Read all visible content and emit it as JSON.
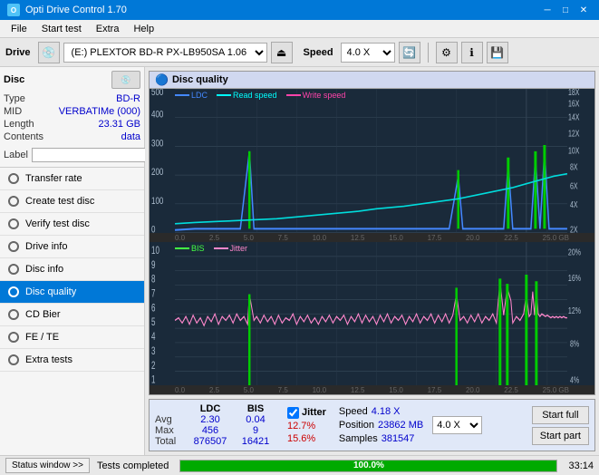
{
  "titlebar": {
    "title": "Opti Drive Control 1.70",
    "icon": "O"
  },
  "menu": {
    "items": [
      "File",
      "Start test",
      "Extra",
      "Help"
    ]
  },
  "toolbar": {
    "drive_label": "Drive",
    "drive_value": "(E:)  PLEXTOR BD-R  PX-LB950SA 1.06",
    "speed_label": "Speed",
    "speed_value": "4.0 X"
  },
  "sidebar": {
    "disc_title": "Disc",
    "disc_info": {
      "type_label": "Type",
      "type_value": "BD-R",
      "mid_label": "MID",
      "mid_value": "VERBATIMe (000)",
      "length_label": "Length",
      "length_value": "23.31 GB",
      "contents_label": "Contents",
      "contents_value": "data",
      "label_label": "Label"
    },
    "nav_items": [
      {
        "id": "transfer-rate",
        "label": "Transfer rate",
        "active": false
      },
      {
        "id": "create-test-disc",
        "label": "Create test disc",
        "active": false
      },
      {
        "id": "verify-test-disc",
        "label": "Verify test disc",
        "active": false
      },
      {
        "id": "drive-info",
        "label": "Drive info",
        "active": false
      },
      {
        "id": "disc-info",
        "label": "Disc info",
        "active": false
      },
      {
        "id": "disc-quality",
        "label": "Disc quality",
        "active": true
      },
      {
        "id": "cd-bier",
        "label": "CD Bier",
        "active": false
      },
      {
        "id": "fe-te",
        "label": "FE / TE",
        "active": false
      },
      {
        "id": "extra-tests",
        "label": "Extra tests",
        "active": false
      }
    ],
    "status_window_btn": "Status window >>"
  },
  "chart": {
    "title": "Disc quality",
    "legend_top": [
      {
        "label": "LDC",
        "color": "#4488ff"
      },
      {
        "label": "Read speed",
        "color": "#00ffff"
      },
      {
        "label": "Write speed",
        "color": "#ff44aa"
      }
    ],
    "legend_bottom": [
      {
        "label": "BIS",
        "color": "#44ff44"
      },
      {
        "label": "Jitter",
        "color": "#ff88cc"
      }
    ],
    "top_y_left": [
      "500",
      "400",
      "300",
      "200",
      "100",
      "0"
    ],
    "top_y_right": [
      "18X",
      "16X",
      "14X",
      "12X",
      "10X",
      "8X",
      "6X",
      "4X",
      "2X"
    ],
    "bottom_y_left": [
      "10",
      "9",
      "8",
      "7",
      "6",
      "5",
      "4",
      "3",
      "2",
      "1"
    ],
    "bottom_y_right": [
      "20%",
      "16%",
      "12%",
      "8%",
      "4%"
    ],
    "x_axis": [
      "0.0",
      "2.5",
      "5.0",
      "7.5",
      "10.0",
      "12.5",
      "15.0",
      "17.5",
      "20.0",
      "22.5",
      "25.0 GB"
    ]
  },
  "stats": {
    "avg_label": "Avg",
    "max_label": "Max",
    "total_label": "Total",
    "ldc_header": "LDC",
    "bis_header": "BIS",
    "jitter_header": "Jitter",
    "speed_label": "Speed",
    "position_label": "Position",
    "samples_label": "Samples",
    "avg_ldc": "2.30",
    "avg_bis": "0.04",
    "avg_jitter": "12.7%",
    "max_ldc": "456",
    "max_bis": "9",
    "max_jitter": "15.6%",
    "total_ldc": "876507",
    "total_bis": "16421",
    "speed_value": "4.18 X",
    "speed_select": "4.0 X",
    "position_value": "23862 MB",
    "samples_value": "381547",
    "start_full_label": "Start full",
    "start_part_label": "Start part"
  },
  "statusbar": {
    "status_text": "Tests completed",
    "progress": "100.0%",
    "progress_value": 100,
    "time": "33:14"
  }
}
